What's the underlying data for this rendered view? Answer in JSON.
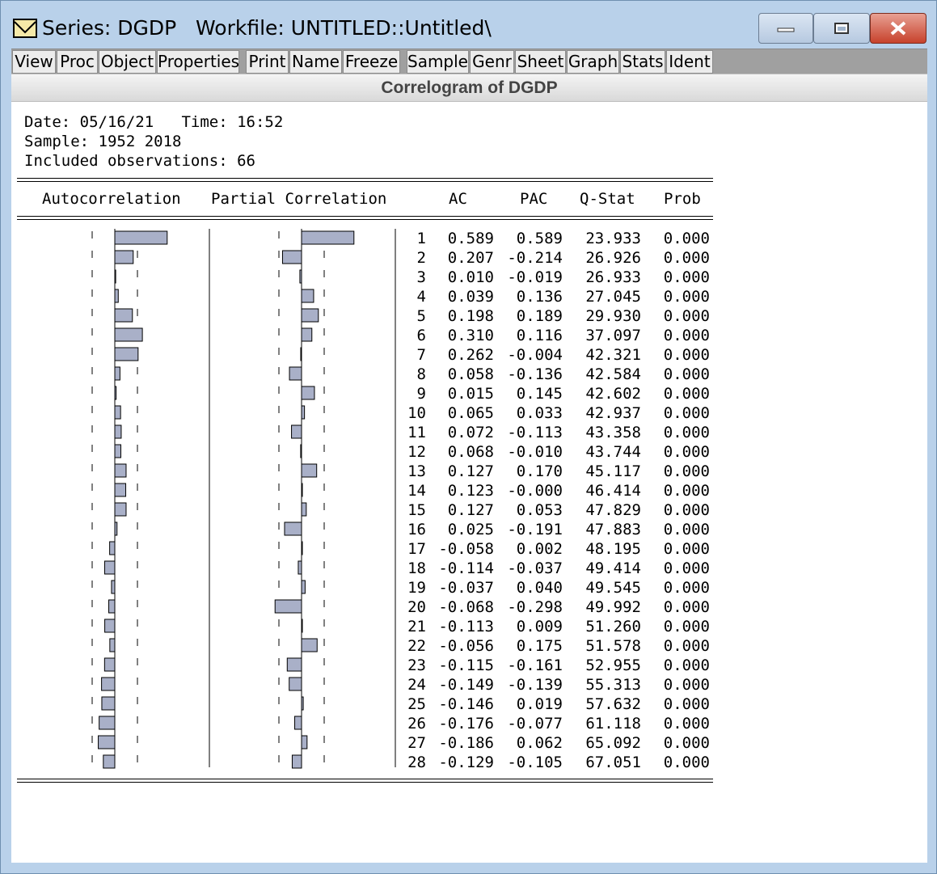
{
  "window": {
    "title": "Series: DGDP   Workfile: UNTITLED::Untitled\\",
    "icon": "series-icon"
  },
  "toolbar": {
    "buttons": [
      "View",
      "Proc",
      "Object",
      "Properties",
      "Print",
      "Name",
      "Freeze",
      "Sample",
      "Genr",
      "Sheet",
      "Graph",
      "Stats",
      "Ident"
    ]
  },
  "view_title": "Correlogram of DGDP",
  "header": {
    "date_line": "Date: 05/16/21   Time: 16:52",
    "sample_line": "Sample: 1952 2018",
    "obs_line": "Included observations: 66"
  },
  "columns": {
    "autocorrelation": "Autocorrelation",
    "partial": "Partial Correlation",
    "ac": "AC",
    "pac": "PAC",
    "qstat": "Q-Stat",
    "prob": "Prob"
  },
  "colors": {
    "bar_fill": "#a9b0c8",
    "bar_stroke": "#000000"
  },
  "chart_data": {
    "type": "table",
    "lags": [
      1,
      2,
      3,
      4,
      5,
      6,
      7,
      8,
      9,
      10,
      11,
      12,
      13,
      14,
      15,
      16,
      17,
      18,
      19,
      20,
      21,
      22,
      23,
      24,
      25,
      26,
      27,
      28
    ],
    "ac_text": [
      "0.589",
      "0.207",
      "0.010",
      "0.039",
      "0.198",
      "0.310",
      "0.262",
      "0.058",
      "0.015",
      "0.065",
      "0.072",
      "0.068",
      "0.127",
      "0.123",
      "0.127",
      "0.025",
      "-0.058",
      "-0.114",
      "-0.037",
      "-0.068",
      "-0.113",
      "-0.056",
      "-0.115",
      "-0.149",
      "-0.146",
      "-0.176",
      "-0.186",
      "-0.129"
    ],
    "pac_text": [
      "0.589",
      "-0.214",
      "-0.019",
      "0.136",
      "0.189",
      "0.116",
      "-0.004",
      "-0.136",
      "0.145",
      "0.033",
      "-0.113",
      "-0.010",
      "0.170",
      "-0.000",
      "0.053",
      "-0.191",
      "0.002",
      "-0.037",
      "0.040",
      "-0.298",
      "0.009",
      "0.175",
      "-0.161",
      "-0.139",
      "0.019",
      "-0.077",
      "0.062",
      "-0.105"
    ],
    "qstat_text": [
      "23.933",
      "26.926",
      "26.933",
      "27.045",
      "29.930",
      "37.097",
      "42.321",
      "42.584",
      "42.602",
      "42.937",
      "43.358",
      "43.744",
      "45.117",
      "46.414",
      "47.829",
      "47.883",
      "48.195",
      "49.414",
      "49.545",
      "49.992",
      "51.260",
      "51.578",
      "52.955",
      "55.313",
      "57.632",
      "61.118",
      "65.092",
      "67.051"
    ],
    "prob_text": [
      "0.000",
      "0.000",
      "0.000",
      "0.000",
      "0.000",
      "0.000",
      "0.000",
      "0.000",
      "0.000",
      "0.000",
      "0.000",
      "0.000",
      "0.000",
      "0.000",
      "0.000",
      "0.000",
      "0.000",
      "0.000",
      "0.000",
      "0.000",
      "0.000",
      "0.000",
      "0.000",
      "0.000",
      "0.000",
      "0.000",
      "0.000",
      "0.000"
    ]
  }
}
